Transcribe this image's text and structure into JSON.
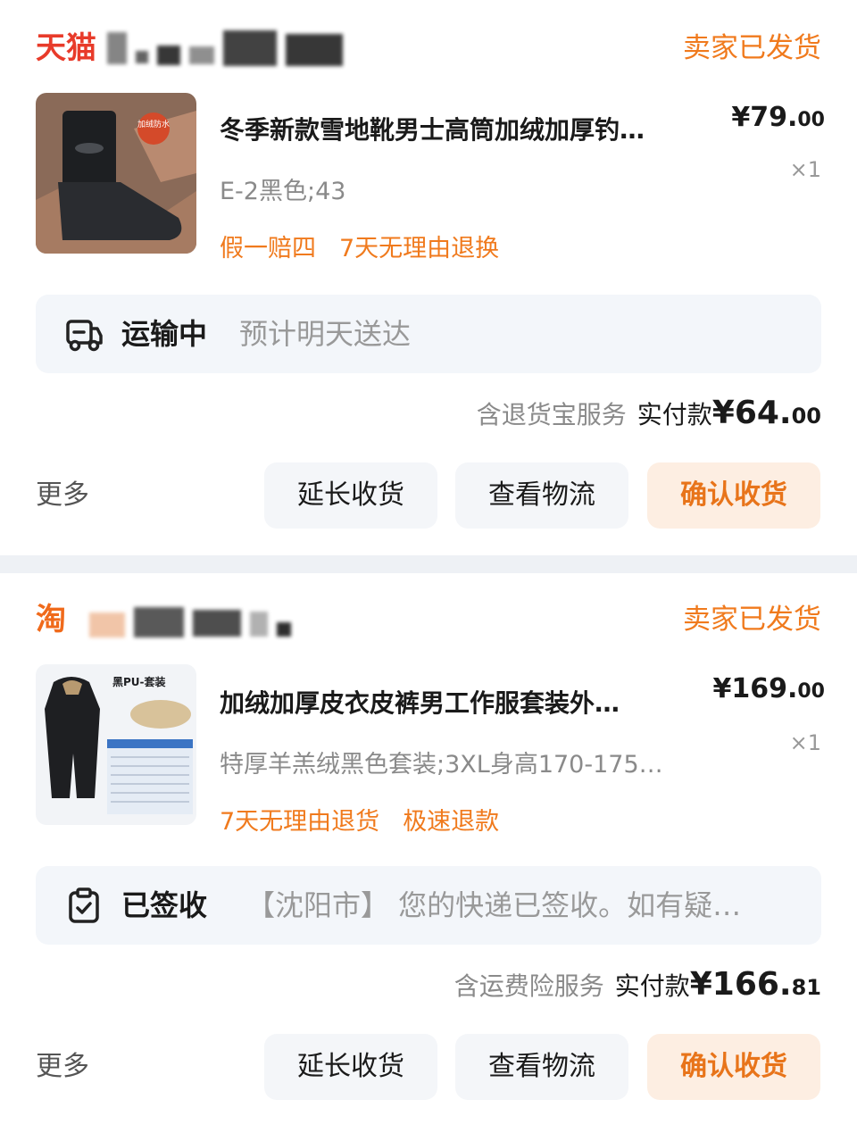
{
  "orders": [
    {
      "platform": {
        "name": "天猫",
        "color": "#e83b2a"
      },
      "shop_name": "",
      "status": "卖家已发货",
      "product": {
        "title": "冬季新款雪地靴男士高筒加绒加厚钓…",
        "price_main": "¥79.",
        "price_cents": "00",
        "quantity": "×1",
        "spec": "E-2黑色;43",
        "tags": [
          "假一赔四",
          "7天无理由退换"
        ],
        "thumb_badge": "加绒防水"
      },
      "tracking": {
        "status": "运输中",
        "detail": "预计明天送达",
        "icon": "truck-icon"
      },
      "payment": {
        "service": "含退货宝服务",
        "label": "实付款",
        "amount_main": "¥64.",
        "amount_cents": "00"
      },
      "actions": {
        "more": "更多",
        "extend": "延长收货",
        "logistics": "查看物流",
        "confirm": "确认收货"
      }
    },
    {
      "platform": {
        "name": "淘",
        "color": "#f06a1b"
      },
      "shop_name": "",
      "status": "卖家已发货",
      "product": {
        "title": "加绒加厚皮衣皮裤男工作服套装外…",
        "price_main": "¥169.",
        "price_cents": "00",
        "quantity": "×1",
        "spec": "特厚羊羔绒黑色套装;3XL身高170-175…",
        "tags": [
          "7天无理由退货",
          "极速退款"
        ],
        "thumb_badge": "黑PU-套装"
      },
      "tracking": {
        "status": "已签收",
        "detail": "【沈阳市】 您的快递已签收。如有疑…",
        "icon": "clipboard-check-icon"
      },
      "payment": {
        "service": "含运费险服务",
        "label": "实付款",
        "amount_main": "¥166.",
        "amount_cents": "81"
      },
      "actions": {
        "more": "更多",
        "extend": "延长收货",
        "logistics": "查看物流",
        "confirm": "确认收货"
      }
    }
  ],
  "colors": {
    "accent": "#f07a1d",
    "track_bg": "#f3f6fa",
    "button_bg": "#f4f6f9",
    "confirm_bg": "#fdeee2"
  }
}
